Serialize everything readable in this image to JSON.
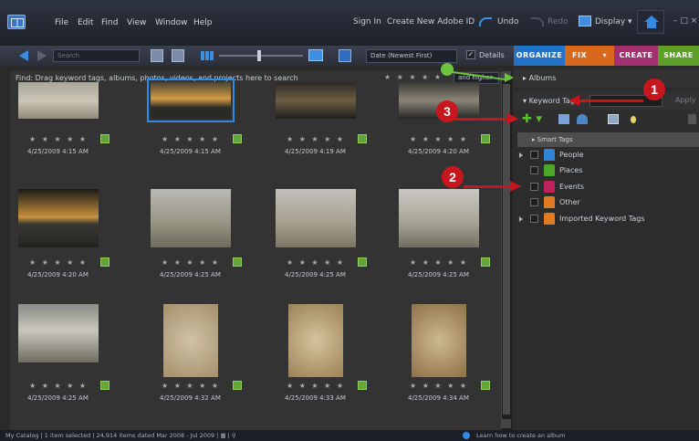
{
  "menu": {
    "items": [
      "File",
      "Edit",
      "Find",
      "View",
      "Window",
      "Help"
    ],
    "sign_in": "Sign In",
    "create_id": "Create New Adobe ID",
    "undo": "Undo",
    "redo": "Redo",
    "display": "Display ▾",
    "window_controls": "– □ ×"
  },
  "toolbar": {
    "search_placeholder": "Search",
    "sort_value": "Date (Newest First)",
    "details_label": "Details",
    "details_check": "✓"
  },
  "tabs": [
    "ORGANIZE",
    "FIX",
    "CREATE",
    "SHARE"
  ],
  "fix_caret": "▾",
  "content": {
    "hint": "Find: Drag keyword tags, albums, photos, videos, and projects here to search",
    "filter_stars": "★ ★ ★ ★ ★",
    "filter_value": "and higher"
  },
  "photos": [
    {
      "caption": "4/25/2009 4:15 AM",
      "stars": "★ ★ ★ ★ ★"
    },
    {
      "caption": "4/25/2009 4:15 AM",
      "stars": "★ ★ ★ ★ ★"
    },
    {
      "caption": "4/25/2009 4:19 AM",
      "stars": "★ ★ ★ ★ ★"
    },
    {
      "caption": "4/25/2009 4:20 AM",
      "stars": "★ ★ ★ ★ ★"
    },
    {
      "caption": "4/25/2009 4:20 AM",
      "stars": "★ ★ ★ ★ ★"
    },
    {
      "caption": "4/25/2009 4:25 AM",
      "stars": "★ ★ ★ ★ ★"
    },
    {
      "caption": "4/25/2009 4:25 AM",
      "stars": "★ ★ ★ ★ ★"
    },
    {
      "caption": "4/25/2009 4:25 AM",
      "stars": "★ ★ ★ ★ ★"
    },
    {
      "caption": "4/25/2009 4:25 AM",
      "stars": "★ ★ ★ ★ ★"
    },
    {
      "caption": "4/25/2009 4:32 AM",
      "stars": "★ ★ ★ ★ ★"
    },
    {
      "caption": "4/25/2009 4:33 AM",
      "stars": "★ ★ ★ ★ ★"
    },
    {
      "caption": "4/25/2009 4:34 AM",
      "stars": "★ ★ ★ ★ ★"
    }
  ],
  "panel": {
    "albums": "Albums",
    "keyword_tags": "Keyword Tags",
    "apply": "Apply",
    "plus": "✚ ▾",
    "smart_tags": "Smart Tags",
    "tags": [
      {
        "label": "People",
        "color": "#2f86d6"
      },
      {
        "label": "Places",
        "color": "#4fa52c"
      },
      {
        "label": "Events",
        "color": "#c2205a"
      },
      {
        "label": "Other",
        "color": "#e07b22"
      },
      {
        "label": "Imported Keyword Tags",
        "color": "#e07b22"
      }
    ]
  },
  "callouts": [
    "1",
    "2",
    "3"
  ],
  "status": {
    "left": "My Catalog  |  1 item selected  |  24,914 items dated Mar 2008 - Jul 2009  |  ▦  |  ⚲",
    "right": "Learn how to create an album"
  }
}
